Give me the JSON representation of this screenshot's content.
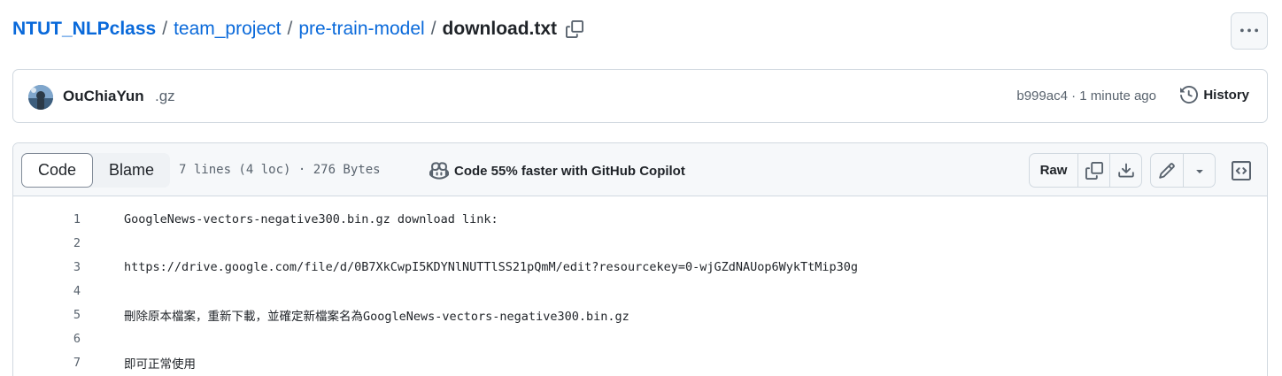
{
  "breadcrumb": {
    "repo": "NTUT_NLPclass",
    "sep1": "/",
    "folder1": "team_project",
    "sep2": "/",
    "folder2": "pre-train-model",
    "sep3": "/",
    "file": "download.txt",
    "copy_icon": "copy-icon"
  },
  "header_actions": {
    "more_icon": "kebab-horizontal-icon"
  },
  "commit": {
    "author": "OuChiaYun",
    "message": ".gz",
    "sha": "b999ac4",
    "separator": " · ",
    "time": "1 minute ago",
    "history_label": "History",
    "history_icon": "history-icon"
  },
  "file_header": {
    "tabs": [
      "Code",
      "Blame"
    ],
    "active_tab": "Code",
    "info": "7 lines (4 loc) · 276 Bytes",
    "copilot_label": "Code 55% faster with GitHub Copilot",
    "copilot_icon": "copilot-icon",
    "raw_label": "Raw",
    "icons": [
      "copy-icon",
      "download-icon",
      "pencil-icon",
      "triangle-down-icon",
      "code-square-icon"
    ]
  },
  "code": {
    "lines": [
      {
        "num": "1",
        "text": "GoogleNews-vectors-negative300.bin.gz download link:"
      },
      {
        "num": "2",
        "text": ""
      },
      {
        "num": "3",
        "text": "https://drive.google.com/file/d/0B7XkCwpI5KDYNlNUTTlSS21pQmM/edit?resourcekey=0-wjGZdNAUop6WykTtMip30g"
      },
      {
        "num": "4",
        "text": ""
      },
      {
        "num": "5",
        "text": "刪除原本檔案，重新下載，並確定新檔案名為GoogleNews-vectors-negative300.bin.gz"
      },
      {
        "num": "6",
        "text": ""
      },
      {
        "num": "7",
        "text": "即可正常使用"
      }
    ]
  },
  "colors": {
    "link": "#0969da",
    "text": "#1f2328",
    "muted": "#59636e",
    "border": "#d1d9e0",
    "header_bg": "#f6f8fa"
  }
}
